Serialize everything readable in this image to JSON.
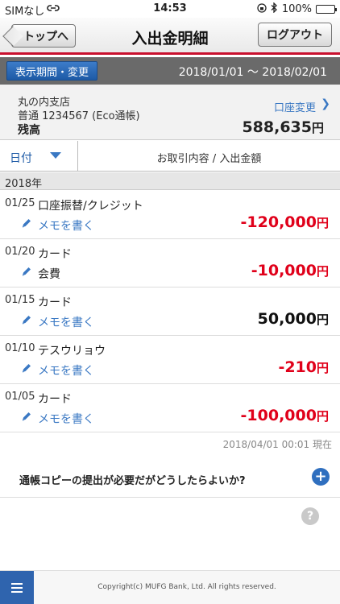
{
  "status_bar": {
    "carrier": "SIMなし",
    "time": "14:53",
    "battery": "100%",
    "battery_level": 1.0
  },
  "header": {
    "back_label": "トップへ",
    "title": "入出金明細",
    "logout_label": "ログアウト",
    "accent_color": "#c8102e"
  },
  "period": {
    "button_label": "表示期間・変更",
    "range": "2018/01/01 ～ 2018/02/01"
  },
  "account": {
    "branch": "丸の内支店",
    "number": "普通 1234567 (Eco通帳)",
    "balance_label": "残高",
    "balance": "588,635",
    "currency": "円",
    "change_label": "口座変更"
  },
  "sort": {
    "date_label": "日付",
    "content_label": "お取引内容 / 入出金額"
  },
  "year": "2018年",
  "transactions": [
    {
      "date": "01/25",
      "description": "口座振替/クレジット",
      "memo": "メモを書く",
      "memo_is_link": true,
      "amount": "-120,000",
      "currency": "円"
    },
    {
      "date": "01/20",
      "description": "カード",
      "memo": "会費",
      "memo_is_link": false,
      "amount": "-10,000",
      "currency": "円"
    },
    {
      "date": "01/15",
      "description": "カード",
      "memo": "メモを書く",
      "memo_is_link": true,
      "amount": "50,000",
      "currency": "円"
    },
    {
      "date": "01/10",
      "description": "テスウリョウ",
      "memo": "メモを書く",
      "memo_is_link": true,
      "amount": "-210",
      "currency": "円"
    },
    {
      "date": "01/05",
      "description": "カード",
      "memo": "メモを書く",
      "memo_is_link": true,
      "amount": "-100,000",
      "currency": "円"
    }
  ],
  "as_of": "2018/04/01 00:01 現在",
  "faq": {
    "question": "通帳コピーの提出が必要だがどうしたらよいか?",
    "expand_icon": "plus-circle-icon"
  },
  "help_icon": "?",
  "footer": {
    "copyright": "Copyright(c) MUFG Bank, Ltd. All rights reserved."
  }
}
